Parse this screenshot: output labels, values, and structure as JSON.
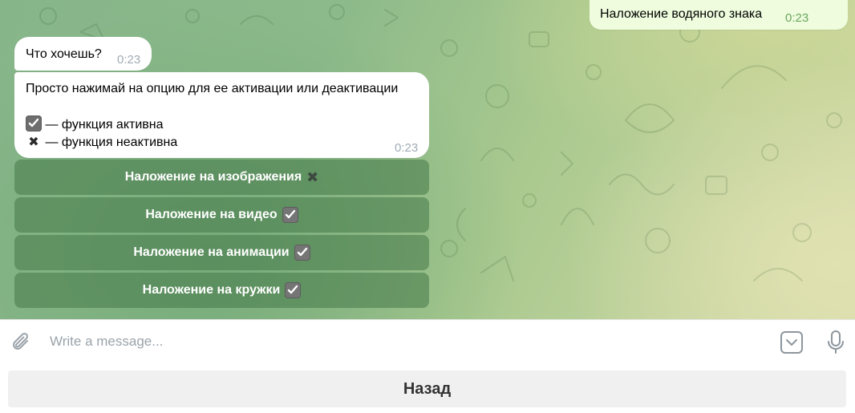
{
  "messages": {
    "outgoing": {
      "text": "Наложение водяного знака",
      "time": "0:23"
    },
    "prompt": {
      "text": "Что хочешь?",
      "time": "0:23"
    },
    "instructions": {
      "line1": "Просто нажимай на опцию для ее активации или деактивации",
      "legend_active": "— функция активна",
      "legend_inactive": "— функция неактивна",
      "time": "0:23"
    }
  },
  "inline_keyboard": [
    {
      "label": "Наложение на изображения",
      "state": "inactive"
    },
    {
      "label": "Наложение на видео",
      "state": "active"
    },
    {
      "label": "Наложение на анимации",
      "state": "active"
    },
    {
      "label": "Наложение на кружки",
      "state": "active"
    }
  ],
  "composer": {
    "placeholder": "Write a message..."
  },
  "reply_keyboard": {
    "back_label": "Назад"
  },
  "icons": {
    "attach": "paperclip-icon",
    "keyboard_toggle": "chevron-down-box-icon",
    "mic": "microphone-icon",
    "read": "double-check-icon",
    "active": "check-box-icon",
    "inactive": "cross-mark-icon"
  },
  "colors": {
    "outgoing_bubble": "#effdde",
    "incoming_bubble": "#ffffff",
    "time_outgoing": "#6aa55f",
    "time_incoming": "#a0acb6",
    "inline_button": "#5f8f60"
  }
}
